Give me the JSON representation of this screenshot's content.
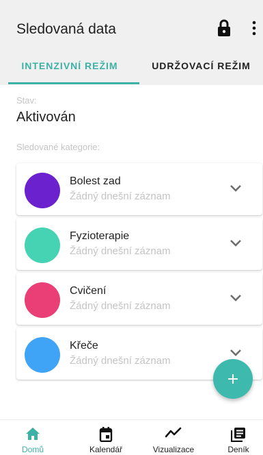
{
  "appbar": {
    "title": "Sledovaná data",
    "lock_icon": "lock-icon",
    "more_icon": "more-vert-icon"
  },
  "tabs": [
    {
      "label": "INTENZIVNÍ REŽIM",
      "active": true
    },
    {
      "label": "UDRŽOVACÍ REŽIM",
      "active": false
    }
  ],
  "status": {
    "label": "Stav:",
    "value": "Aktivován"
  },
  "categories_label": "Sledované kategorie:",
  "categories": [
    {
      "name": "Bolest zad",
      "subtitle": "Žádný dnešní záznam",
      "color": "#6c21cf"
    },
    {
      "name": "Fyzioterapie",
      "subtitle": "Žádný dnešní záznam",
      "color": "#45d3b4"
    },
    {
      "name": "Cvičení",
      "subtitle": "Žádný dnešní záznam",
      "color": "#ea3f76"
    },
    {
      "name": "Křeče",
      "subtitle": "Žádný dnešní záznam",
      "color": "#3fa4f6"
    }
  ],
  "fab": {
    "icon": "plus-icon",
    "color": "#3db9ae"
  },
  "bottom_nav": [
    {
      "label": "Domů",
      "icon": "home-icon",
      "active": true
    },
    {
      "label": "Kalendář",
      "icon": "calendar-icon",
      "active": false
    },
    {
      "label": "Vizualizace",
      "icon": "trend-icon",
      "active": false
    },
    {
      "label": "Deník",
      "icon": "diary-icon",
      "active": false
    }
  ],
  "colors": {
    "accent": "#3db1a6",
    "appbar_bg": "#f0f0f0"
  }
}
